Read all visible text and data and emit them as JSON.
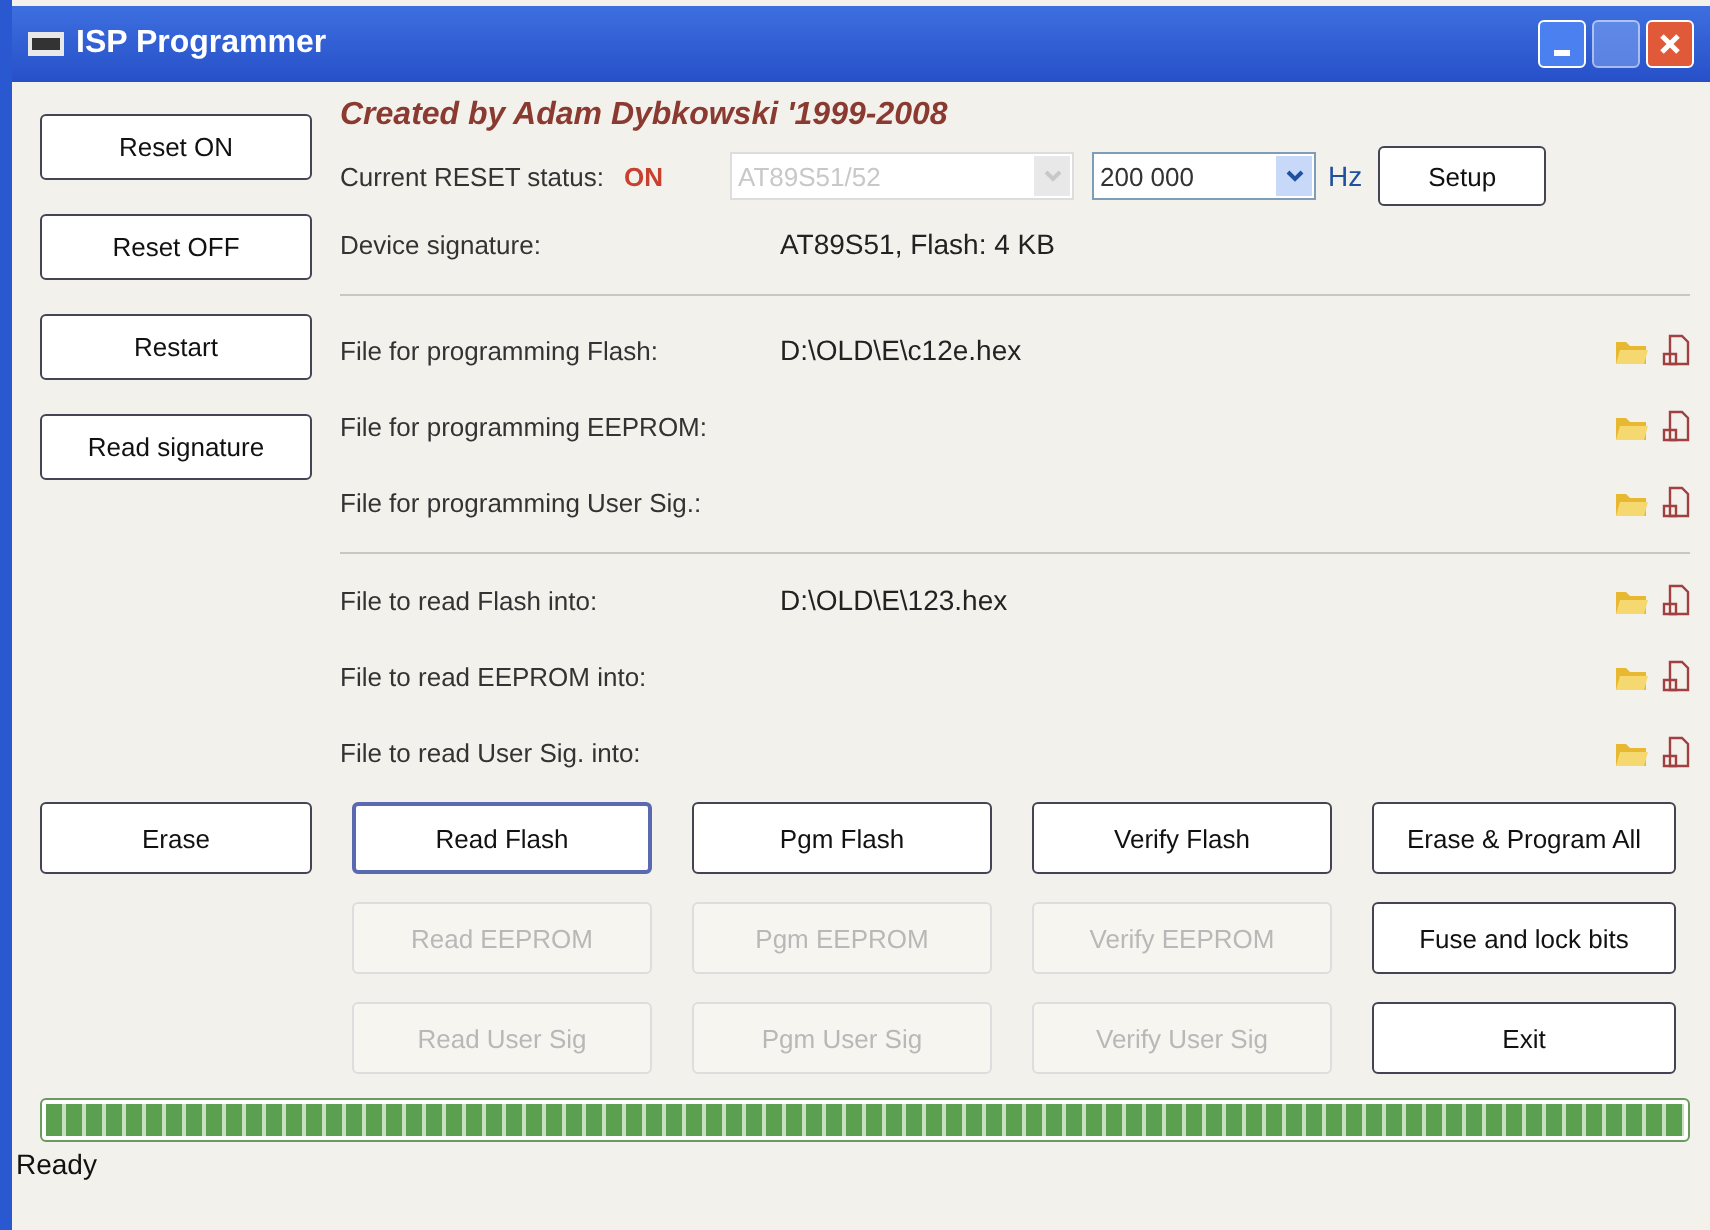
{
  "window": {
    "title": "ISP Programmer"
  },
  "side_buttons": [
    {
      "label": "Reset ON",
      "disabled": false
    },
    {
      "label": "Reset OFF",
      "disabled": false
    },
    {
      "label": "Restart",
      "disabled": false
    },
    {
      "label": "Read signature",
      "disabled": false
    }
  ],
  "credit": "Created by Adam Dybkowski '1999-2008",
  "reset_status": {
    "label": "Current RESET status:",
    "value": "ON"
  },
  "device_combo": {
    "value": "AT89S51/52",
    "disabled": true
  },
  "frequency": {
    "value": "200 000",
    "unit": "Hz"
  },
  "setup_button": "Setup",
  "signature": {
    "label": "Device signature:",
    "value": "AT89S51, Flash: 4 KB"
  },
  "program_files": [
    {
      "label": "File for programming Flash:",
      "path": "D:\\OLD\\E\\c12e.hex"
    },
    {
      "label": "File for programming EEPROM:"
    },
    {
      "label": "File for programming User Sig.:"
    }
  ],
  "read_files": [
    {
      "label": "File to read Flash into:",
      "path": "D:\\OLD\\E\\123.hex"
    },
    {
      "label": "File to read EEPROM into:"
    },
    {
      "label": "File to read User Sig. into:"
    }
  ],
  "action_rows": [
    [
      {
        "label": "Erase",
        "disabled": false
      },
      {
        "label": "Read Flash",
        "disabled": false,
        "focused": true
      },
      {
        "label": "Pgm Flash",
        "disabled": false
      },
      {
        "label": "Verify Flash",
        "disabled": false
      },
      {
        "label": "Erase & Program All",
        "disabled": false
      }
    ],
    [
      null,
      {
        "label": "Read EEPROM",
        "disabled": true
      },
      {
        "label": "Pgm EEPROM",
        "disabled": true
      },
      {
        "label": "Verify EEPROM",
        "disabled": true
      },
      {
        "label": "Fuse and lock bits",
        "disabled": false
      }
    ],
    [
      null,
      {
        "label": "Read User Sig",
        "disabled": true
      },
      {
        "label": "Pgm User Sig",
        "disabled": true
      },
      {
        "label": "Verify User Sig",
        "disabled": true
      },
      {
        "label": "Exit",
        "disabled": false
      }
    ]
  ],
  "progress": {
    "level": 1
  },
  "status_bar": "Ready"
}
